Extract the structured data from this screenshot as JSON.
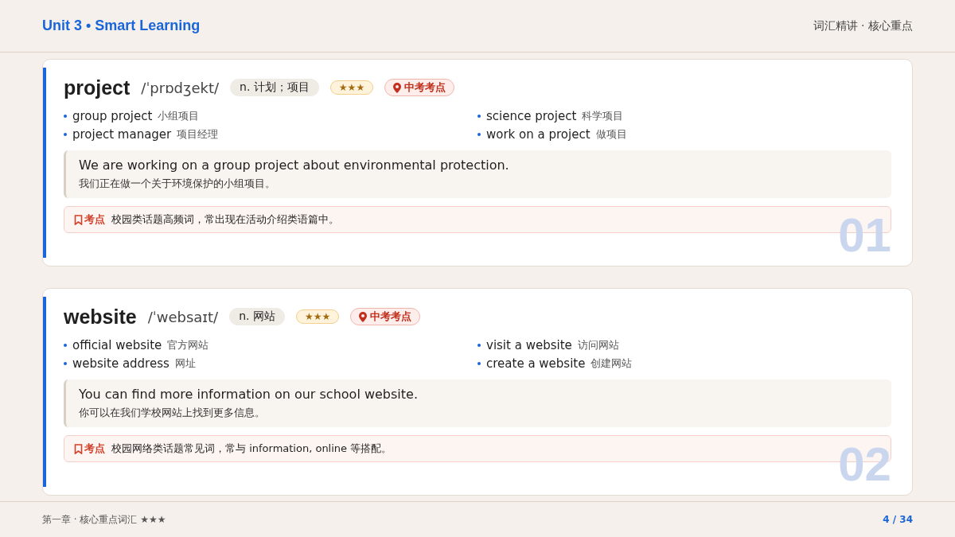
{
  "header": {
    "title": "Unit 3 • Smart Learning",
    "subtitle": "词汇精讲 · 核心重点"
  },
  "words": [
    {
      "word": "project",
      "phonetic": "/ˈprɒdʒekt/",
      "meaning": "n. 计划；项目",
      "stars": "★★★",
      "tag": "中考考点",
      "collocations": [
        {
          "en": "group project",
          "zh": "小组项目"
        },
        {
          "en": "science project",
          "zh": "科学项目"
        },
        {
          "en": "project manager",
          "zh": "项目经理"
        },
        {
          "en": "work on a project",
          "zh": "做项目"
        }
      ],
      "example": {
        "en": "We are working on a group project about environmental protection.",
        "zh": "我们正在做一个关于环境保护的小组项目。"
      },
      "tip": {
        "label": "考点",
        "text": "校园类话题高频词，常出现在活动介绍类语篇中。"
      },
      "number": "01"
    },
    {
      "word": "website",
      "phonetic": "/ˈwebsaɪt/",
      "meaning": "n. 网站",
      "stars": "★★★",
      "tag": "中考考点",
      "collocations": [
        {
          "en": "official website",
          "zh": "官方网站"
        },
        {
          "en": "visit a website",
          "zh": "访问网站"
        },
        {
          "en": "website address",
          "zh": "网址"
        },
        {
          "en": "create a website",
          "zh": "创建网站"
        }
      ],
      "example": {
        "en": "You can find more information on our school website.",
        "zh": "你可以在我们学校网站上找到更多信息。"
      },
      "tip": {
        "label": "考点",
        "text": "校园网络类话题常见词，常与 information, online 等搭配。"
      },
      "number": "02"
    }
  ],
  "footer": {
    "chapter": "第一章 · 核心重点词汇 ★★★",
    "page": "4 / 34"
  }
}
